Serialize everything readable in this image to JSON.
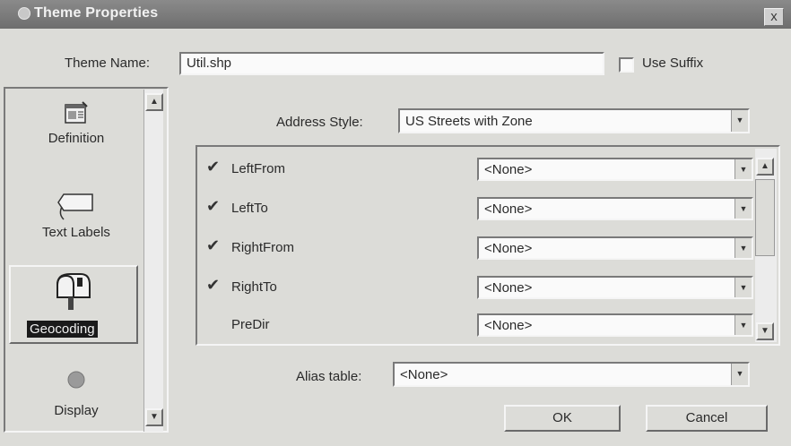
{
  "window": {
    "title": "Theme Properties",
    "close_label": "x",
    "icon": "globe-icon"
  },
  "theme_name": {
    "label": "Theme Name:",
    "value": "Util.shp"
  },
  "use_suffix": {
    "label": "Use Suffix",
    "checked": false
  },
  "nav": {
    "items": [
      {
        "label": "Definition",
        "icon": "definition-icon",
        "selected": false
      },
      {
        "label": "Text Labels",
        "icon": "text-labels-icon",
        "selected": false
      },
      {
        "label": "Geocoding",
        "icon": "mailbox-icon",
        "selected": true
      },
      {
        "label": "Display",
        "icon": "display-icon",
        "selected": false
      }
    ]
  },
  "geocoding": {
    "address_style_label": "Address Style:",
    "address_style_value": "US Streets with Zone",
    "fields": [
      {
        "label": "LeftFrom",
        "checked": true,
        "value": "<None>"
      },
      {
        "label": "LeftTo",
        "checked": true,
        "value": "<None>"
      },
      {
        "label": "RightFrom",
        "checked": true,
        "value": "<None>"
      },
      {
        "label": "RightTo",
        "checked": true,
        "value": "<None>"
      },
      {
        "label": "PreDir",
        "checked": false,
        "value": "<None>"
      }
    ],
    "alias_label": "Alias table:",
    "alias_value": "<None>"
  },
  "buttons": {
    "ok": "OK",
    "cancel": "Cancel"
  },
  "colors": {
    "titlebar": "#7a7a7a",
    "face": "#dcdcd8",
    "selection": "#1a1a1a"
  }
}
